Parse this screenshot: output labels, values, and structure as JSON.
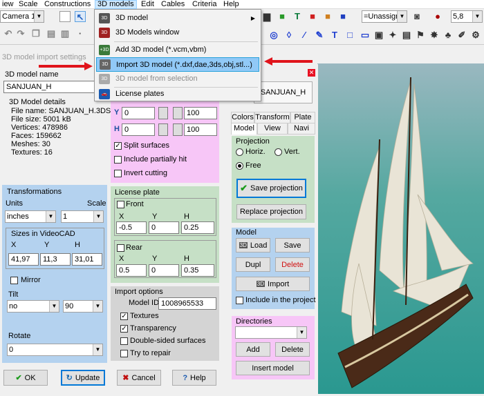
{
  "menubar": {
    "items": [
      "iew",
      "Scale",
      "Constructions",
      "3D models",
      "Edit",
      "Cables",
      "Criteria",
      "Help"
    ]
  },
  "toolbar": {
    "camera": "Camera 1",
    "assign": "=Unassigne",
    "zoom": "5,8"
  },
  "dropdown": {
    "items": [
      {
        "label": "3D model",
        "icon": "box-3d-icon",
        "arrow": "▶"
      },
      {
        "label": "3D Models window",
        "icon": "window-3d-icon"
      },
      {
        "label": "Add 3D model (*.vcm,vbm)",
        "icon": "add-model-icon"
      },
      {
        "label": "Import 3D model (*.dxf,dae,3ds,obj,stl...)",
        "icon": "import-model-icon"
      },
      {
        "label": "3D model from selection",
        "icon": "selection-model-icon"
      },
      {
        "label": "License plates",
        "icon": "car-icon"
      }
    ]
  },
  "dialog": {
    "title": "3D model import settings",
    "model_name_label": "3D model name",
    "model_name": "SANJUAN_H",
    "details": {
      "title": "3D Model details",
      "lines": [
        "File name: SANJUAN_H.3DS",
        "File size: 5001 kB",
        "Vertices: 478986",
        "Faces: 159662",
        "Meshes: 30",
        "Textures: 16"
      ]
    },
    "cut": {
      "y_label": "Y",
      "y_val": "0",
      "y2": "100",
      "h_label": "H",
      "h_val": "0",
      "h2": "100",
      "split": "Split surfaces",
      "partial": "Include partially hit",
      "invert": "Invert cutting"
    },
    "transform": {
      "title": "Transformations",
      "units_label": "Units",
      "scale_label": "Scale",
      "units": "inches",
      "scale": "1",
      "sizes_title": "Sizes in VideoCAD",
      "x_label": "X",
      "y_label": "Y",
      "h_label": "H",
      "x": "41,97",
      "y": "11,3",
      "h": "31,01",
      "mirror": "Mirror",
      "tilt_label": "Tilt",
      "tilt_axis": "no",
      "tilt_val": "90",
      "rotate_label": "Rotate",
      "rotate": "0"
    },
    "license": {
      "title": "License plate",
      "front": "Front",
      "rear": "Rear",
      "x": "X",
      "y": "Y",
      "h": "H",
      "front_vals": [
        "-0.5",
        "0",
        "0.25"
      ],
      "rear_vals": [
        "0.5",
        "0",
        "0.35"
      ]
    },
    "import": {
      "title": "Import options",
      "model_id_label": "Model ID",
      "model_id": "1008965533",
      "textures": "Textures",
      "transparency": "Transparency",
      "double": "Double-sided surfaces",
      "repair": "Try to repair"
    },
    "buttons": {
      "ok": "OK",
      "update": "Update",
      "cancel": "Cancel",
      "help": "Help"
    },
    "right": {
      "name_btn": "SANJUAN_H",
      "tabs_top": [
        "Colors",
        "Transform",
        "Plate"
      ],
      "tabs_bottom": [
        "Model",
        "View",
        "Navi"
      ],
      "projection": {
        "title": "Projection",
        "horiz": "Horiz.",
        "vert": "Vert.",
        "free": "Free",
        "save": "Save projection",
        "replace": "Replace projection"
      },
      "model": {
        "title": "Model",
        "load": "Load",
        "save": "Save",
        "dupl": "Dupl",
        "delete": "Delete",
        "import": "Import",
        "include": "Include in the project"
      },
      "dirs": {
        "title": "Directories",
        "add": "Add",
        "delete": "Delete",
        "insert": "Insert model"
      }
    }
  },
  "colors": {
    "pink": "#f7c6f7",
    "blue": "#b4d2ef",
    "green": "#c6e0c6",
    "gray": "#d4d4d4",
    "accent": "#e0141b"
  }
}
